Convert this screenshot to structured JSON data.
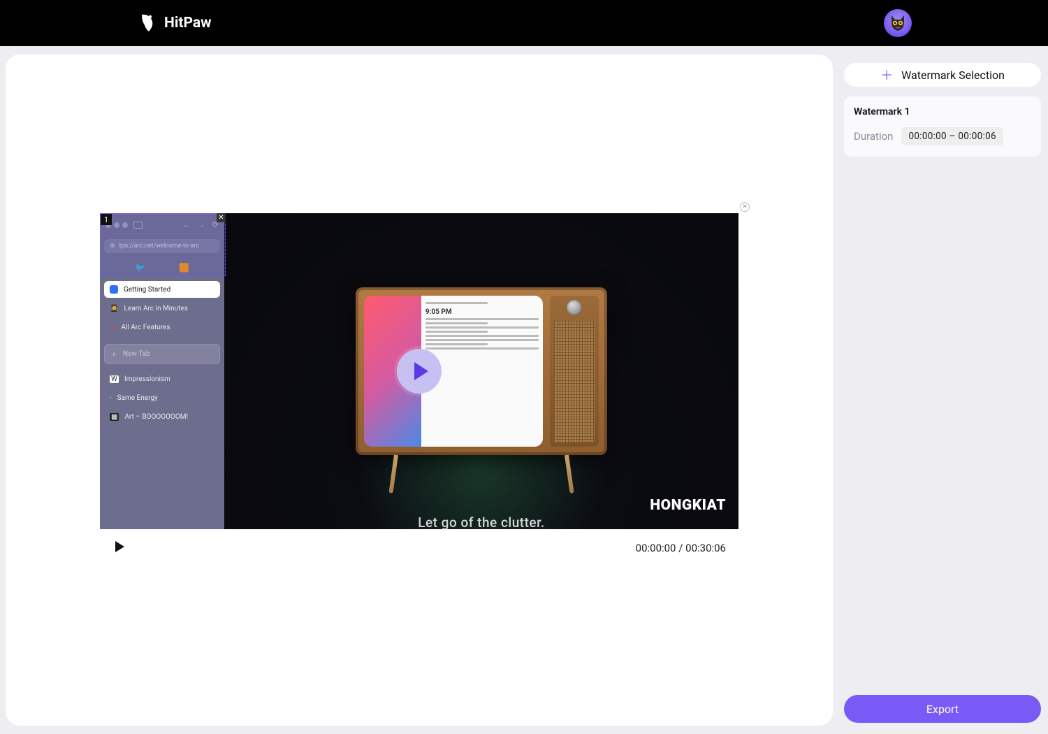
{
  "header": {
    "brand": "HitPaw"
  },
  "canvas": {
    "selection_number": "1",
    "arc": {
      "url": "tps://arc.net/welcome-to-arc",
      "active_item": "Getting Started",
      "items": {
        "learn": "Learn Arc in Minutes",
        "features": "All Arc Features",
        "newtab": "New Tab",
        "impression": "Impressionism",
        "energy": "Same Energy",
        "art": "Art – BOOOOOOOM!"
      }
    },
    "tv": {
      "time_label": "9:05 PM",
      "brand_text": "HONGKIAT",
      "caption": "Let go of the clutter."
    }
  },
  "player": {
    "current_time": "00:00:00",
    "total_time": "00:30:06"
  },
  "sidebar": {
    "add_label": "Watermark Selection",
    "watermark_title": "Watermark 1",
    "duration_label": "Duration",
    "duration_start": "00:00:00",
    "duration_end": "00:00:06"
  },
  "actions": {
    "export_label": "Export"
  }
}
